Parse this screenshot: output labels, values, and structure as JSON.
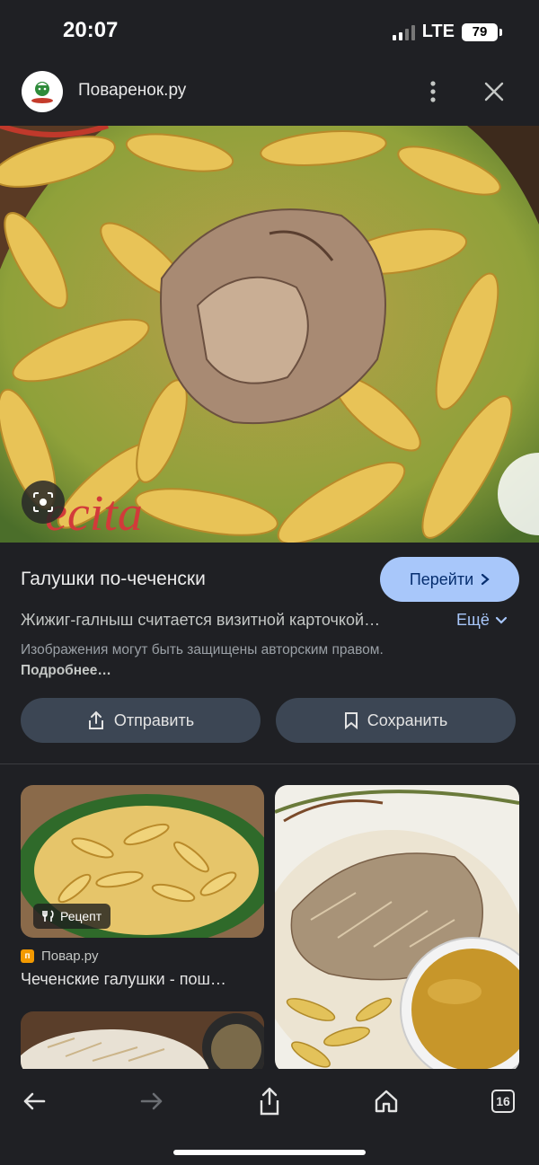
{
  "status_bar": {
    "time": "20:07",
    "network": "LTE",
    "battery": "79"
  },
  "source": {
    "site_name": "Поваренок.ру"
  },
  "result": {
    "title": "Галушки по-чеченски",
    "goto_label": "Перейти",
    "description": "Жижиг-галныш считается визитной карточкой…",
    "more_label": "Ещё",
    "copyright_text": "Изображения могут быть защищены авторским правом.",
    "copyright_link": "Подробнее…",
    "watermark": "ecita"
  },
  "actions": {
    "share_label": "Отправить",
    "save_label": "Сохранить"
  },
  "related": [
    {
      "badge": "Рецепт",
      "source": "Повар.ру",
      "favicon_letter": "п",
      "title": "Чеченские галушки - пош…"
    }
  ],
  "toolbar": {
    "tab_count": "16"
  },
  "colors": {
    "accent": "#a8c7fa",
    "background": "#1f2024",
    "chip": "#3c4654"
  }
}
